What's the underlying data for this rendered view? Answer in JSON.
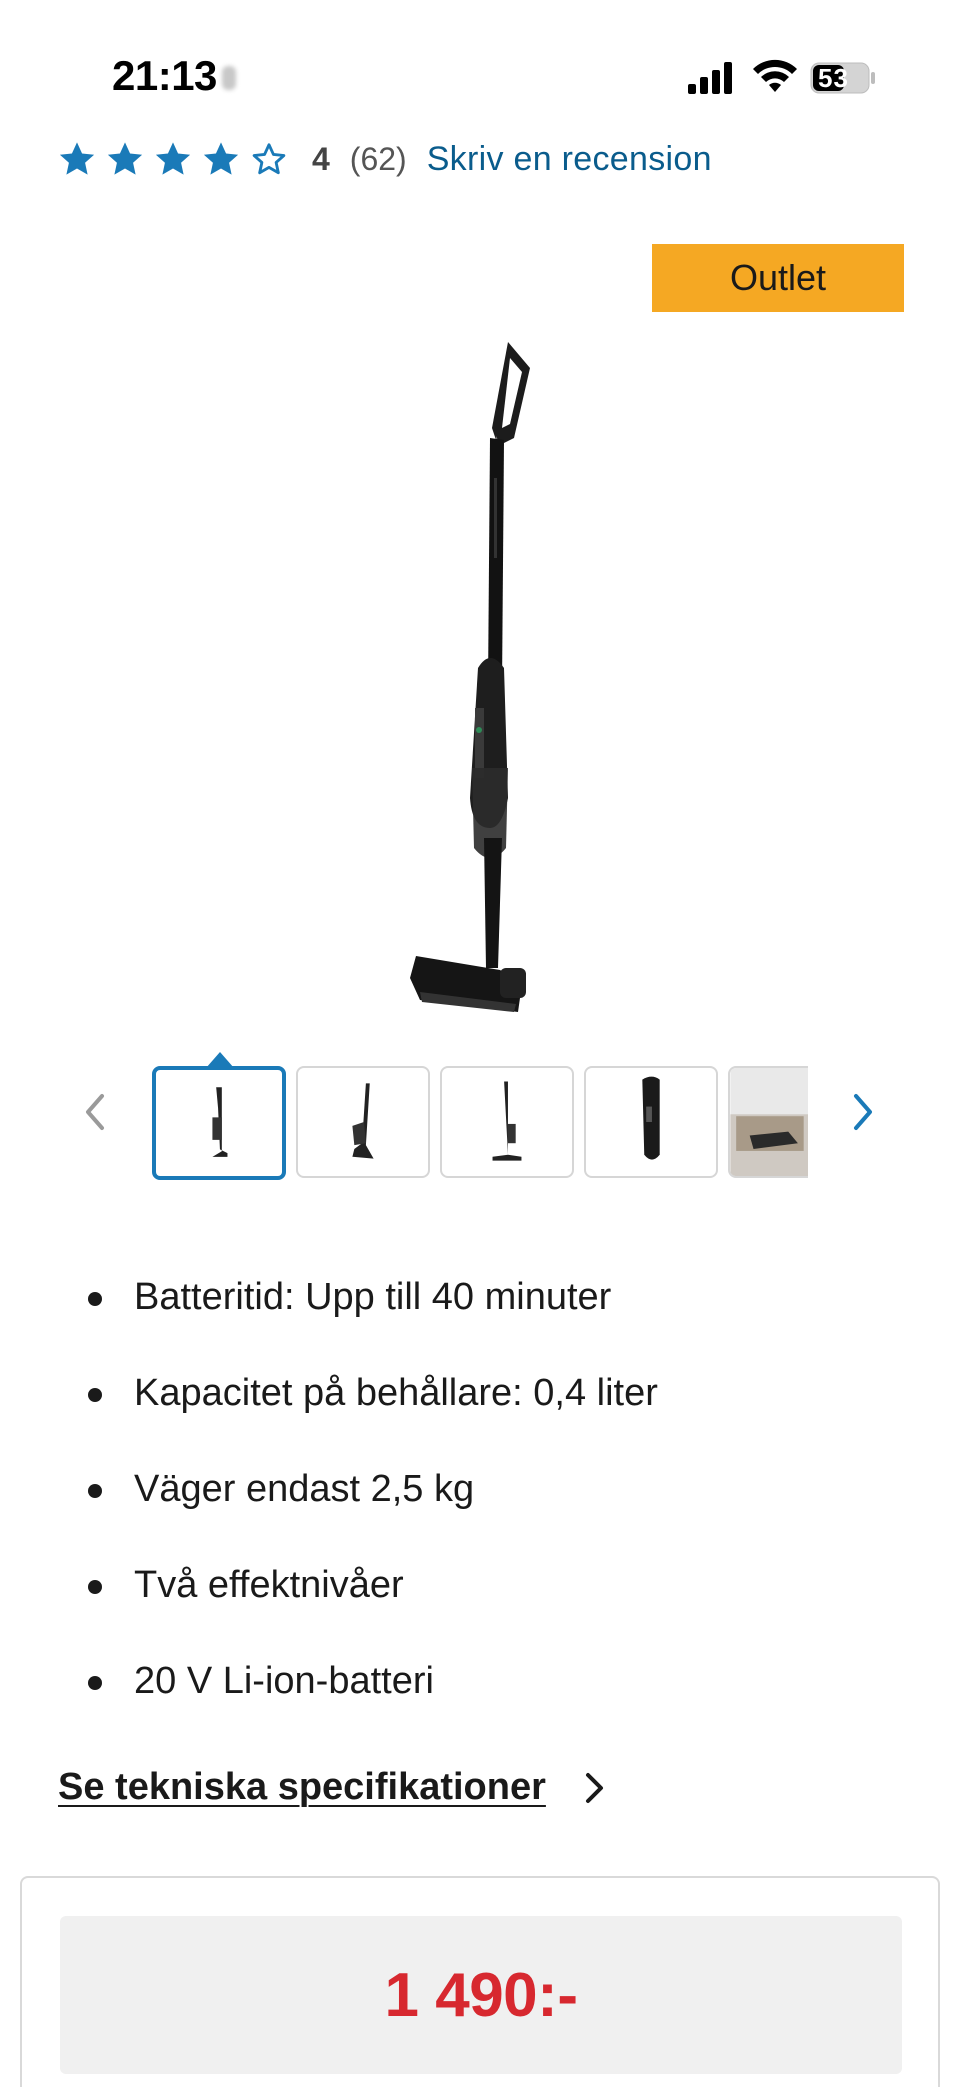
{
  "status_bar": {
    "time": "21:13",
    "battery_level": "53"
  },
  "rating": {
    "stars": 4,
    "max_stars": 5,
    "value": "4",
    "count": "(62)",
    "review_link": "Skriv en recension",
    "star_color": "#1a7ab8"
  },
  "product": {
    "badge": "Outlet",
    "badge_color": "#f5a823",
    "image_icon": "stick-vacuum-image"
  },
  "thumbnails": {
    "prev_icon": "chevron-left-icon",
    "next_icon": "chevron-right-icon",
    "selected_index": 0,
    "items": [
      {
        "name": "thumbnail-1-vacuum-front"
      },
      {
        "name": "thumbnail-2-vacuum-angled"
      },
      {
        "name": "thumbnail-3-vacuum-side"
      },
      {
        "name": "thumbnail-4-handheld-unit"
      },
      {
        "name": "thumbnail-5-vacuum-in-room"
      }
    ]
  },
  "features": [
    "Batteritid: Upp till 40 minuter",
    "Kapacitet på behållare: 0,4 liter",
    "Väger endast 2,5 kg",
    "Två effektnivåer",
    "20 V Li-ion-batteri"
  ],
  "specs_link": "Se tekniska specifikationer",
  "price": {
    "value": "1 490:-",
    "color": "#d7282f"
  }
}
